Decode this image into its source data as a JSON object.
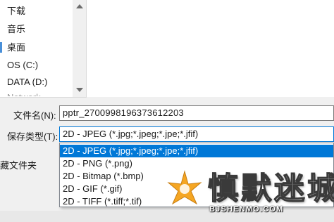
{
  "nav": {
    "items": [
      {
        "label": "下载"
      },
      {
        "label": "音乐"
      },
      {
        "label": "桌面"
      },
      {
        "label": "OS (C:)"
      },
      {
        "label": "DATA (D:)"
      },
      {
        "label": "Network"
      }
    ],
    "selected_index": 2
  },
  "form": {
    "filename_label": "文件名(N):",
    "filename_value": "pptr_2700998196373612203",
    "filetype_label": "保存类型(T):",
    "filetype_value": "2D - JPEG (*.jpg;*.jpeg;*.jpe;*.jfif)"
  },
  "dropdown": {
    "options": [
      {
        "label": "2D - JPEG (*.jpg;*.jpeg;*.jpe;*.jfif)"
      },
      {
        "label": "2D - PNG (*.png)"
      },
      {
        "label": "2D - Bitmap (*.bmp)"
      },
      {
        "label": "2D - GIF (*.gif)"
      },
      {
        "label": "2D - TIFF (*.tiff;*.tif)"
      }
    ],
    "selected_index": 0
  },
  "footer": {
    "hide_folders_label": "藏文件夹"
  },
  "watermark": {
    "title": "慎默迷城",
    "subtitle": "BJSHENMO.COM",
    "accent_color": "#f5a623"
  }
}
